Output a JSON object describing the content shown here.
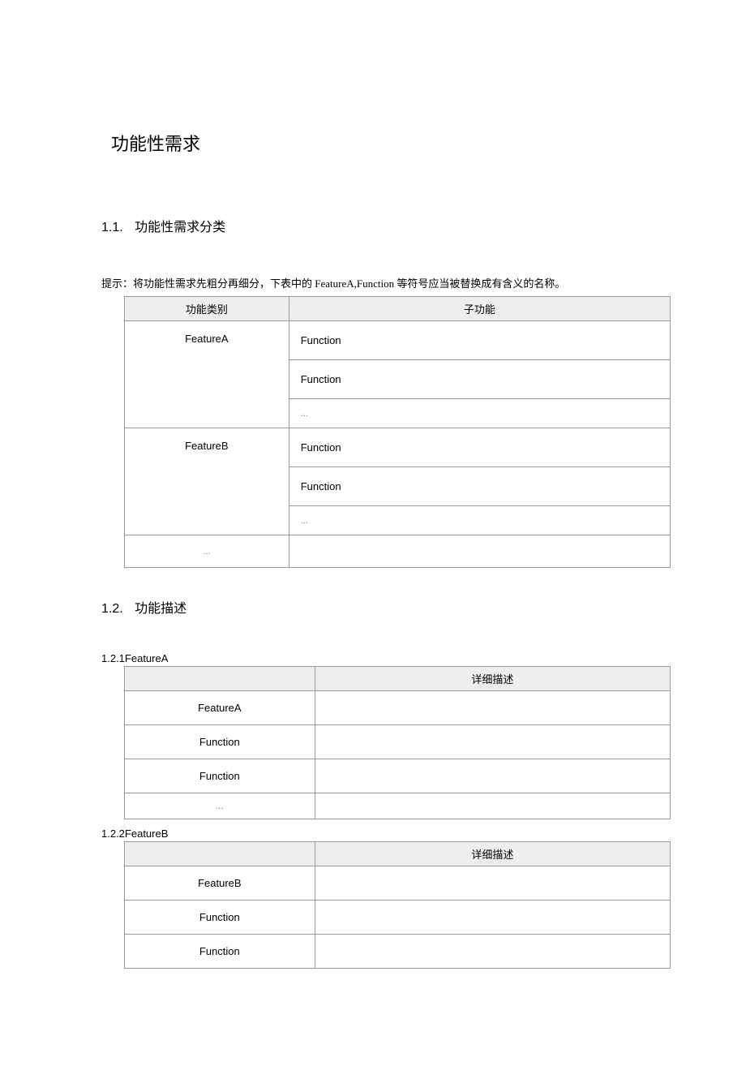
{
  "title": "功能性需求",
  "section1": {
    "num": "1.1.",
    "heading": "功能性需求分类",
    "para": "提示：将功能性需求先粗分再细分，下表中的 FeatureA,Function 等符号应当被替换成有含义的名称。",
    "table": {
      "headers": [
        "功能类别",
        "子功能"
      ],
      "rows": [
        {
          "feature": "FeatureA",
          "functions": [
            "Function",
            "Function",
            "..."
          ]
        },
        {
          "feature": "FeatureB",
          "functions": [
            "Function",
            "Function",
            "..."
          ]
        },
        {
          "feature": "...",
          "functions": [
            ""
          ]
        }
      ]
    }
  },
  "section2": {
    "num": "1.2.",
    "heading": "功能描述",
    "subsections": [
      {
        "num": "1.2.1",
        "title": "FeatureA",
        "table": {
          "headers": [
            "",
            "详细描述"
          ],
          "rows": [
            {
              "label": "FeatureA",
              "desc": ""
            },
            {
              "label": "Function",
              "desc": ""
            },
            {
              "label": "Function",
              "desc": ""
            },
            {
              "label": "...",
              "desc": ""
            }
          ]
        }
      },
      {
        "num": "1.2.2",
        "title": "FeatureB",
        "table": {
          "headers": [
            "",
            "详细描述"
          ],
          "rows": [
            {
              "label": "FeatureB",
              "desc": ""
            },
            {
              "label": "Function",
              "desc": ""
            },
            {
              "label": "Function",
              "desc": ""
            }
          ]
        }
      }
    ]
  }
}
